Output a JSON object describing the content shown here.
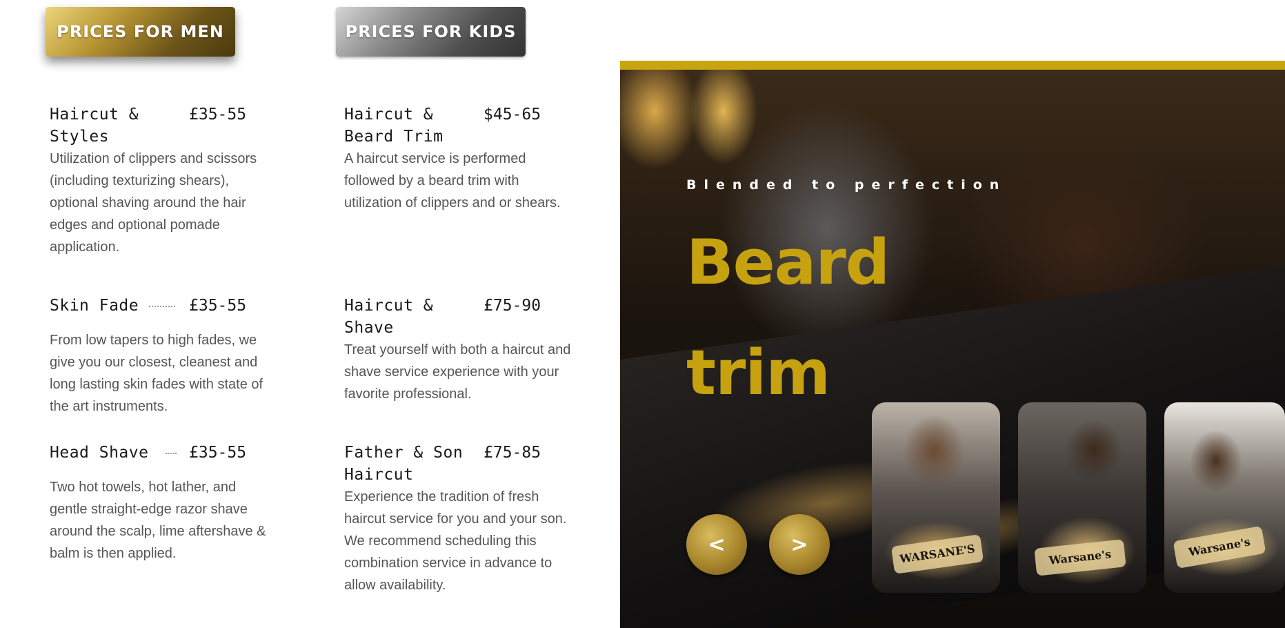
{
  "tabs": {
    "men_label": "PRICES FOR MEN",
    "kids_label": "PRICES FOR KIDS"
  },
  "men_services": [
    {
      "name": "Haircut & Styles",
      "price": "£35-55",
      "description": "Utilization of clippers and scissors (including texturizing shears), optional shaving around the hair edges and optional pomade application."
    },
    {
      "name": "Skin Fade",
      "price": "£35-55",
      "description": "From low tapers to high fades, we give you our closest, cleanest and long lasting skin fades with state of the art instruments."
    },
    {
      "name": "Head Shave",
      "price": "£35-55",
      "description": "Two hot towels, hot lather, and gentle straight-edge razor shave around the scalp, lime aftershave & balm is then applied."
    }
  ],
  "kids_services": [
    {
      "name": "Haircut & Beard Trim",
      "price": "$45-65",
      "description": "A haircut service is performed followed by a beard trim with utilization of clippers and or shears."
    },
    {
      "name": "Haircut & Shave",
      "price": "£75-90",
      "description": "Treat yourself with both a haircut and shave service experience with your favorite professional."
    },
    {
      "name": "Father & Son Haircut",
      "price": "£75-85",
      "description": "Experience the tradition of fresh haircut service for you and your son. We recommend scheduling this combination service in advance to allow availability."
    }
  ],
  "hero": {
    "eyebrow": "Blended to perfection",
    "title": "Beard trim"
  },
  "slider": {
    "prev_label": "<",
    "next_label": ">",
    "cards": [
      {
        "badge": "WARSANE'S"
      },
      {
        "badge": "Warsane's"
      },
      {
        "badge": "Warsane's"
      }
    ]
  },
  "colors": {
    "accent_gold": "#c7a210",
    "border_gold": "#c9a412"
  }
}
